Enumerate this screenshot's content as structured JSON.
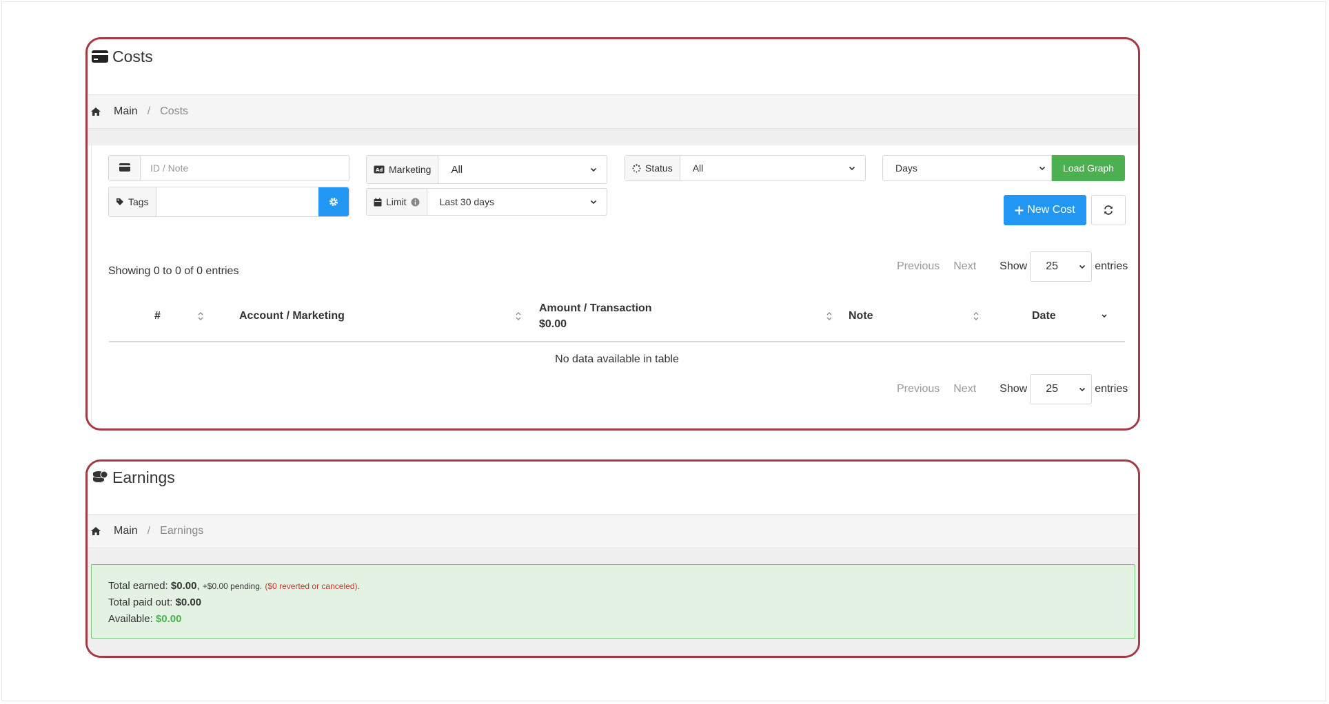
{
  "costs": {
    "title": "Costs",
    "breadcrumb": {
      "main": "Main",
      "current": "Costs"
    },
    "filters": {
      "id_note_placeholder": "ID / Note",
      "tags_label": "Tags",
      "marketing_label": "Marketing",
      "marketing_value": "All",
      "limit_label": "Limit",
      "limit_value": "Last 30 days",
      "status_label": "Status",
      "status_value": "All",
      "graph_period_value": "Days",
      "load_graph_label": "Load Graph"
    },
    "new_cost_label": "New Cost",
    "table": {
      "info": "Showing 0 to 0 of 0 entries",
      "previous_label": "Previous",
      "next_label": "Next",
      "show_label": "Show",
      "entries_label": "entries",
      "page_length": "25",
      "columns": {
        "index": "#",
        "account": "Account / Marketing",
        "amount": "Amount / Transaction",
        "amount_total": "$0.00",
        "note": "Note",
        "date": "Date"
      },
      "empty_message": "No data available in table"
    }
  },
  "earnings": {
    "title": "Earnings",
    "breadcrumb": {
      "main": "Main",
      "current": "Earnings"
    },
    "summary": {
      "total_earned_label": "Total earned:",
      "total_earned_value": "$0.00",
      "pending_text": "+$0.00 pending.",
      "reverted_text": "($0 reverted or canceled)",
      "total_paid_label": "Total paid out:",
      "total_paid_value": "$0.00",
      "available_label": "Available:",
      "available_value": "$0.00"
    }
  },
  "colors": {
    "panel_border": "#a33a44",
    "primary": "#2196f3",
    "success": "#4caf50",
    "alert_bg": "#e3f2e3",
    "danger": "#c0392b"
  }
}
